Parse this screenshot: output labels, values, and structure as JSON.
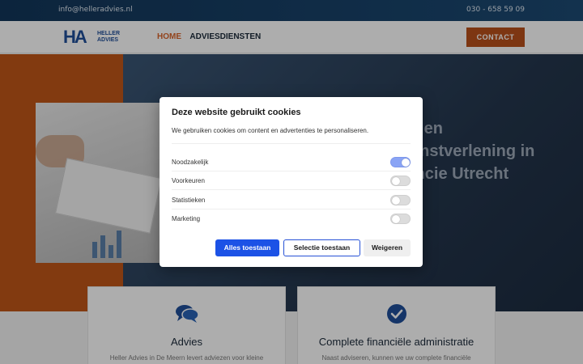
{
  "topbar": {
    "email": "info@helleradvies.nl",
    "phone": "030 - 658 59 09"
  },
  "header": {
    "logo_letters": "HA",
    "logo_name_line1": "HELLER",
    "logo_name_line2": "ADVIES",
    "nav": [
      {
        "label": "HOME",
        "active": true
      },
      {
        "label": "ADVIESDIENSTEN",
        "active": false
      }
    ],
    "contact_label": "CONTACT"
  },
  "hero": {
    "title_line1": "e en",
    "title_line2": "enstverlening in",
    "title_line3": "incie Utrecht"
  },
  "cards": [
    {
      "icon": "chat-bubbles-icon",
      "title": "Advies",
      "text": "Heller Advies in De Meern levert adviezen voor kleine"
    },
    {
      "icon": "check-circle-icon",
      "title": "Complete financiële administratie",
      "text": "Naast adviseren, kunnen we uw complete financiële"
    }
  ],
  "cookie_modal": {
    "title": "Deze website gebruikt cookies",
    "description": "We gebruiken cookies om content en advertenties te personaliseren.",
    "options": [
      {
        "label": "Noodzakelijk",
        "enabled": true
      },
      {
        "label": "Voorkeuren",
        "enabled": false
      },
      {
        "label": "Statistieken",
        "enabled": false
      },
      {
        "label": "Marketing",
        "enabled": false
      }
    ],
    "buttons": {
      "allow_all": "Alles toestaan",
      "allow_selection": "Selectie toestaan",
      "deny": "Weigeren"
    }
  },
  "colors": {
    "brand_blue": "#1f4e9a",
    "brand_orange": "#d9642a",
    "contact_button": "#b9501b",
    "primary_button": "#1c52e6",
    "toggle_on": "#8aa4f5"
  }
}
